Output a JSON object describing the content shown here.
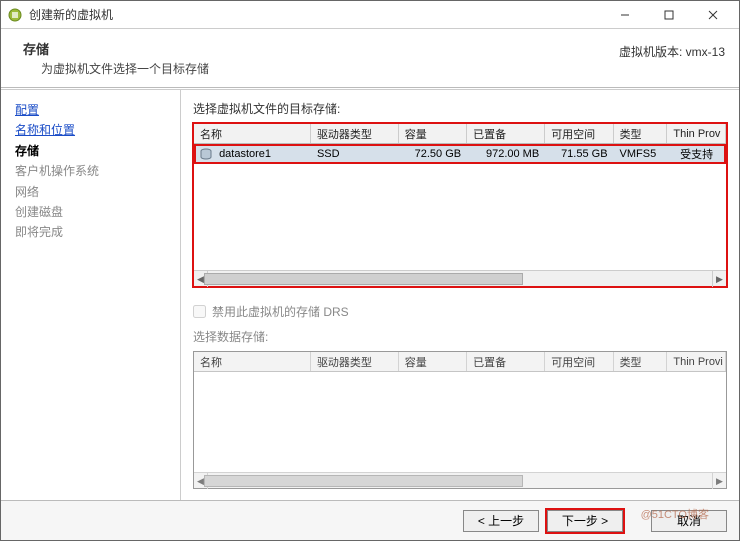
{
  "titlebar": {
    "title": "创建新的虚拟机"
  },
  "header": {
    "title": "存储",
    "subtitle": "为虚拟机文件选择一个目标存储",
    "version_label": "虚拟机版本: vmx-13"
  },
  "sidebar": {
    "items": [
      {
        "label": "配置",
        "state": "link"
      },
      {
        "label": "名称和位置",
        "state": "link"
      },
      {
        "label": "存储",
        "state": "current"
      },
      {
        "label": "客户机操作系统",
        "state": "disabled"
      },
      {
        "label": "网络",
        "state": "disabled"
      },
      {
        "label": "创建磁盘",
        "state": "disabled"
      },
      {
        "label": "即将完成",
        "state": "disabled"
      }
    ]
  },
  "main": {
    "section1_label": "选择虚拟机文件的目标存储:",
    "columns": {
      "name": "名称",
      "drive_type": "驱动器类型",
      "capacity": "容量",
      "provisioned": "已置备",
      "free": "可用空间",
      "type": "类型",
      "thin": "Thin Prov"
    },
    "rows": [
      {
        "name": "datastore1",
        "drive_type": "SSD",
        "capacity": "72.50 GB",
        "provisioned": "972.00 MB",
        "free": "71.55 GB",
        "type": "VMFS5",
        "thin": "受支持"
      }
    ],
    "drs_checkbox_label": "禁用此虚拟机的存储 DRS",
    "section2_label": "选择数据存储:",
    "columns2_thin": "Thin Provi"
  },
  "footer": {
    "back": "< 上一步",
    "next": "下一步 >",
    "cancel": "取消"
  },
  "watermark": "@51CTO博客"
}
